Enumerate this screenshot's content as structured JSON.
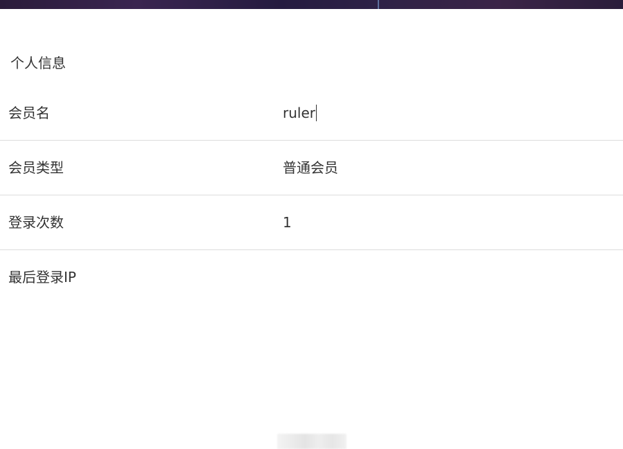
{
  "section": {
    "title": "个人信息"
  },
  "rows": [
    {
      "label": "会员名",
      "value": "ruler"
    },
    {
      "label": "会员类型",
      "value": "普通会员"
    },
    {
      "label": "登录次数",
      "value": "1"
    },
    {
      "label": "最后登录IP",
      "value": ""
    }
  ]
}
